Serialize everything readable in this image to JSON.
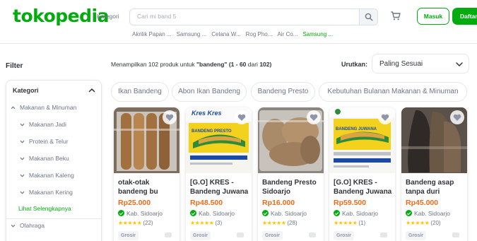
{
  "header": {
    "logo": "tokopedia",
    "kategori_label": "Kategori",
    "search_placeholder": "Cari mi band 5",
    "suggestions": [
      "Akrilik Papan ...",
      "Samsung ...",
      "Celana W...",
      "Rog Pho...",
      "Air Co...",
      "Samsung ..."
    ],
    "masuk_label": "Masuk",
    "daftar_label": "Daftar"
  },
  "sidebar": {
    "filter_title": "Filter",
    "section_title": "Kategori",
    "items": [
      {
        "label": "Makanan & Minuman",
        "level": 0,
        "expanded": true
      },
      {
        "label": "Makanan Jadi",
        "level": 1
      },
      {
        "label": "Protein & Telur",
        "level": 1
      },
      {
        "label": "Makanan Beku",
        "level": 1
      },
      {
        "label": "Makanan Kaleng",
        "level": 1
      },
      {
        "label": "Makanan Kering",
        "level": 1
      }
    ],
    "more_label": "Lihat Selengkapnya",
    "next_section": "Olahraga"
  },
  "results": {
    "prefix": "Menampilkan 102 produk untuk ",
    "query": "\"bandeng\"",
    "range": "(1 - 60",
    "middle": " dari ",
    "total": "102)",
    "sort_label": "Urutkan:",
    "sort_value": "Paling Sesuai"
  },
  "chips": [
    "Ikan Bandeng",
    "Abon Ikan Bandeng",
    "Bandeng Presto",
    "Kebutuhan Bulanan Makanan & Minuman"
  ],
  "products": [
    {
      "name": "otak-otak bandeng bu",
      "price": "Rp25.000",
      "location": "Kab. Sidoarjo",
      "stars": "★★★★★",
      "reviews": "(22)",
      "tag": "Grosir"
    },
    {
      "name": "[G.O] KRES - Bandeng Juwana",
      "price": "Rp48.500",
      "location": "Kab. Sidoarjo",
      "stars": "★★★★★",
      "reviews": "(3)",
      "tag": "Grosir",
      "img_text": "Kres Kres",
      "img_label": "BANDENG PRESTO"
    },
    {
      "name": "Bandeng Presto Sidoarjo",
      "price": "Rp16.000",
      "location": "Kab. Sidoarjo",
      "stars": "★★★★★",
      "reviews": "(28)",
      "tag": "Grosir"
    },
    {
      "name": "[G.O] KRES - Bandeng Juwana",
      "price": "Rp59.500",
      "location": "Kab. Sidoarjo",
      "stars": "★★★★★",
      "reviews": "(1)",
      "tag": "Grosir",
      "img_label": "BANDENG JUWANA"
    },
    {
      "name": "Bandeng asap tanpa duri",
      "price": "Rp45.000",
      "location": "Kab. Sidoarjo",
      "stars": "★★★★★",
      "reviews": "(20)",
      "tag": "Grosir"
    }
  ],
  "colors": {
    "brand": "#03ac0e",
    "price": "#ef6b1b",
    "star": "#ffc400"
  }
}
